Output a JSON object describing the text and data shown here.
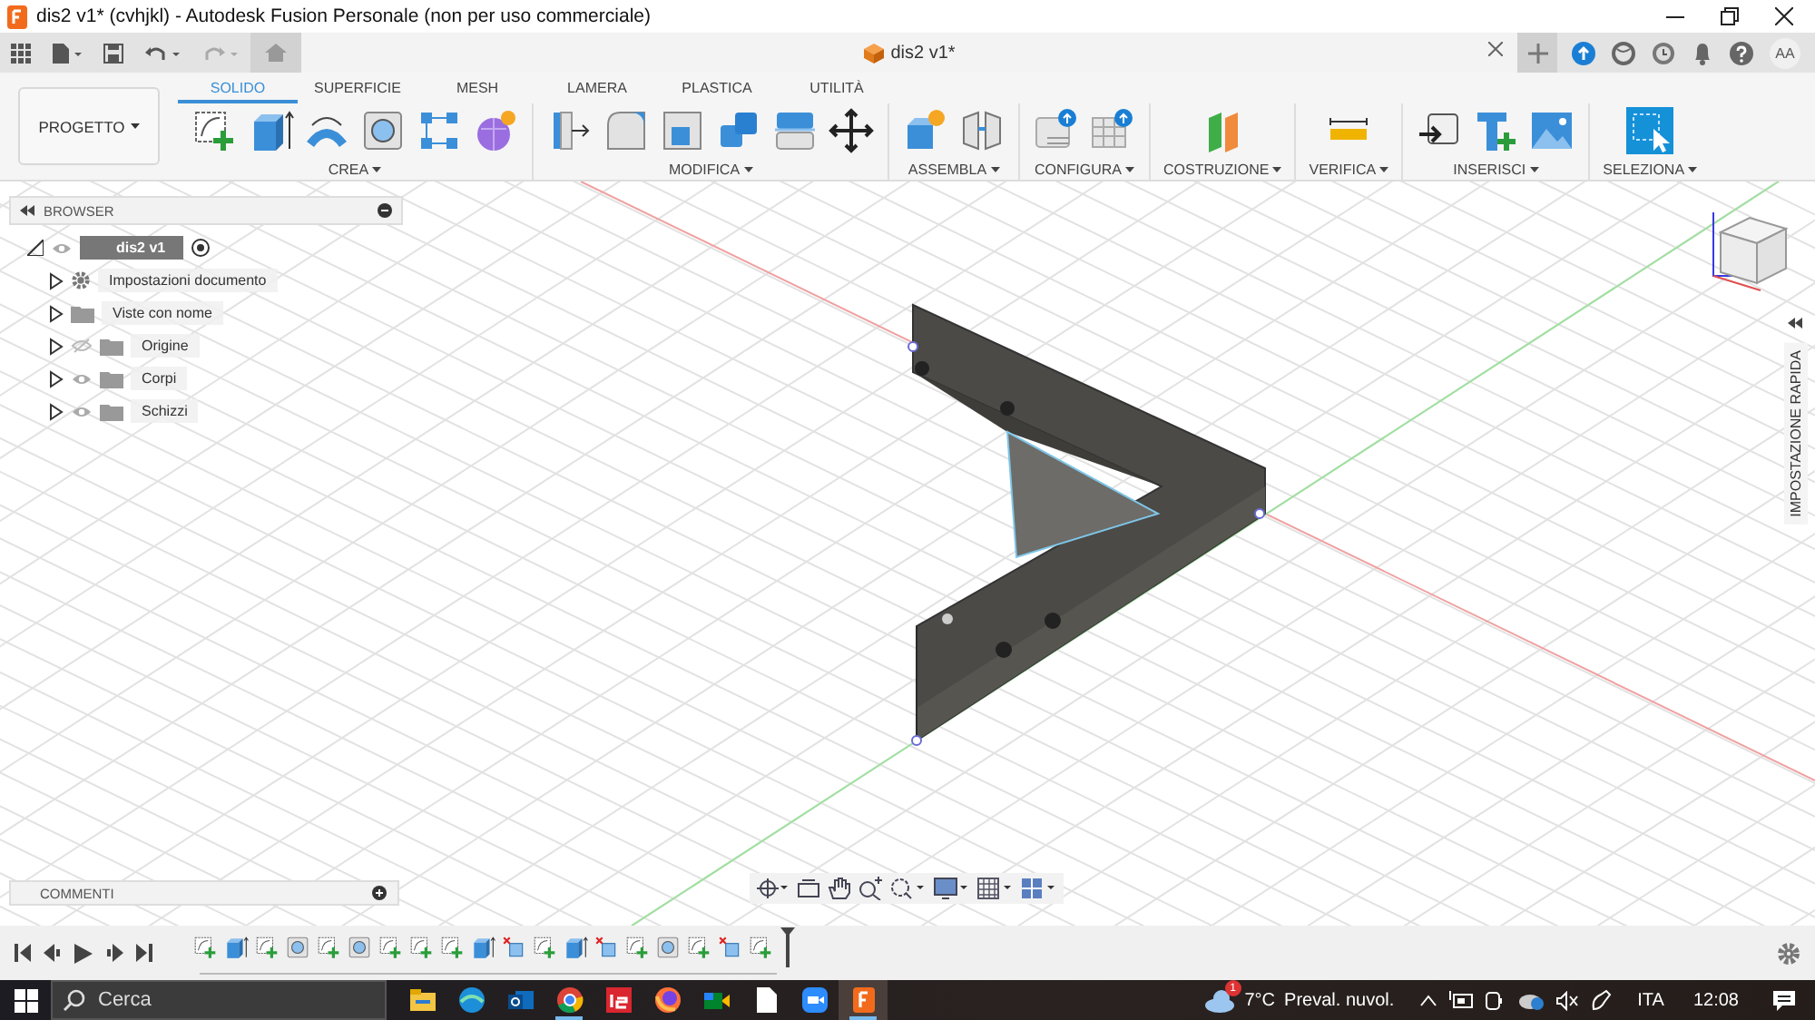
{
  "window": {
    "title": "dis2 v1* (cvhjkl) - Autodesk Fusion Personale (non per uso commerciale)"
  },
  "document_tab": {
    "title": "dis2 v1*"
  },
  "user": {
    "initials": "AA"
  },
  "project_button": {
    "label": "PROGETTO"
  },
  "workspace_tabs": [
    {
      "label": "SOLIDO",
      "selected": true
    },
    {
      "label": "SUPERFICIE",
      "selected": false
    },
    {
      "label": "MESH",
      "selected": false
    },
    {
      "label": "LAMERA",
      "selected": false
    },
    {
      "label": "PLASTICA",
      "selected": false
    },
    {
      "label": "UTILITÀ",
      "selected": false
    }
  ],
  "tool_groups": [
    {
      "label": "CREA",
      "tools": [
        {
          "kind": "sketch"
        },
        {
          "kind": "extrude"
        },
        {
          "kind": "sweep"
        },
        {
          "kind": "hole"
        },
        {
          "kind": "pattern"
        },
        {
          "kind": "form"
        }
      ]
    },
    {
      "label": "MODIFICA",
      "tools": [
        {
          "kind": "press"
        },
        {
          "kind": "fillet"
        },
        {
          "kind": "shell"
        },
        {
          "kind": "combine"
        },
        {
          "kind": "split"
        },
        {
          "kind": "move"
        }
      ]
    },
    {
      "label": "ASSEMBLA",
      "tools": [
        {
          "kind": "component"
        },
        {
          "kind": "joint"
        }
      ]
    },
    {
      "label": "CONFIGURA",
      "tools": [
        {
          "kind": "config"
        },
        {
          "kind": "table"
        }
      ]
    },
    {
      "label": "COSTRUZIONE",
      "tools": [
        {
          "kind": "plane"
        }
      ]
    },
    {
      "label": "VERIFICA",
      "tools": [
        {
          "kind": "measure"
        }
      ]
    },
    {
      "label": "INSERISCI",
      "tools": [
        {
          "kind": "import"
        },
        {
          "kind": "mcmaster"
        },
        {
          "kind": "image"
        }
      ]
    },
    {
      "label": "SELEZIONA",
      "tools": [
        {
          "kind": "select"
        }
      ]
    }
  ],
  "browser": {
    "title": "BROWSER",
    "root": {
      "label": "dis2 v1",
      "visible": true,
      "children": [
        {
          "kind": "settings",
          "label": "Impostazioni documento"
        },
        {
          "kind": "views",
          "label": "Viste con nome"
        },
        {
          "kind": "folder",
          "label": "Origine",
          "visible": false
        },
        {
          "kind": "folder",
          "label": "Corpi",
          "visible": true
        },
        {
          "kind": "folder",
          "label": "Schizzi",
          "visible": true
        }
      ]
    }
  },
  "comments": {
    "title": "COMMENTI"
  },
  "quick_setup": {
    "label": "IMPOSTAZIONE RAPIDA"
  },
  "timeline": {
    "features": [
      {
        "kind": "sketch"
      },
      {
        "kind": "extrude"
      },
      {
        "kind": "sketch"
      },
      {
        "kind": "hole"
      },
      {
        "kind": "sketch"
      },
      {
        "kind": "hole"
      },
      {
        "kind": "sketch"
      },
      {
        "kind": "sketch"
      },
      {
        "kind": "sketch"
      },
      {
        "kind": "extrude"
      },
      {
        "kind": "delete"
      },
      {
        "kind": "sketch"
      },
      {
        "kind": "extrude"
      },
      {
        "kind": "delete"
      },
      {
        "kind": "sketch"
      },
      {
        "kind": "hole"
      },
      {
        "kind": "sketch"
      },
      {
        "kind": "delete"
      },
      {
        "kind": "sketch"
      }
    ]
  },
  "taskbar": {
    "search": {
      "placeholder": "Cerca"
    },
    "apps": [
      {
        "kind": "explorer",
        "running": false,
        "selected": false
      },
      {
        "kind": "edge",
        "running": false,
        "selected": false
      },
      {
        "kind": "outlook",
        "running": false,
        "selected": false
      },
      {
        "kind": "chrome",
        "running": true,
        "selected": false
      },
      {
        "kind": "issuu",
        "running": false,
        "selected": false
      },
      {
        "kind": "firefox",
        "running": false,
        "selected": false
      },
      {
        "kind": "meet",
        "running": false,
        "selected": false
      },
      {
        "kind": "notepad",
        "running": false,
        "selected": false
      },
      {
        "kind": "zoom",
        "running": false,
        "selected": false
      },
      {
        "kind": "fusion",
        "running": true,
        "selected": true
      }
    ],
    "weather": {
      "badge": "1",
      "temperature": "7°C",
      "condition": "Preval. nuvol."
    },
    "language": "ITA",
    "time": "12:08"
  }
}
